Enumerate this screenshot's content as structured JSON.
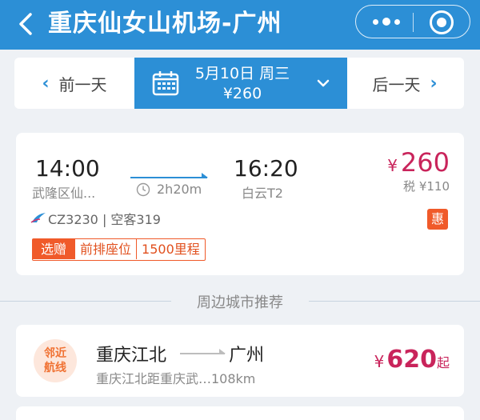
{
  "header": {
    "title": "重庆仙女山机场-广州",
    "back_icon": "chevron-left-icon",
    "more_icon": "more-dots-icon",
    "close_icon": "miniprogram-close-icon"
  },
  "date_bar": {
    "prev_label": "前一天",
    "next_label": "后一天",
    "date": "5月10日 周三",
    "price": "¥260"
  },
  "flight": {
    "dep_time": "14:00",
    "dep_airport": "武隆区仙...",
    "duration": "2h20m",
    "arr_time": "16:20",
    "arr_airport": "白云T2",
    "price_currency": "¥",
    "price": "260",
    "tax": "税 ¥110",
    "discount_badge": "惠",
    "flight_info": "CZ3230 | 空客319",
    "tags": [
      "选赠",
      "前排座位",
      "1500里程"
    ]
  },
  "section": {
    "title": "周边城市推荐"
  },
  "recommend": {
    "badge_line1": "邻近",
    "badge_line2": "航线",
    "from": "重庆江北",
    "to": "广州",
    "desc": "重庆江北距重庆武…108km",
    "price_currency": "¥",
    "price": "620",
    "price_suffix": "起"
  },
  "colors": {
    "primary": "#2c8fd6",
    "price": "#c9245b",
    "accent": "#f05a2a"
  }
}
